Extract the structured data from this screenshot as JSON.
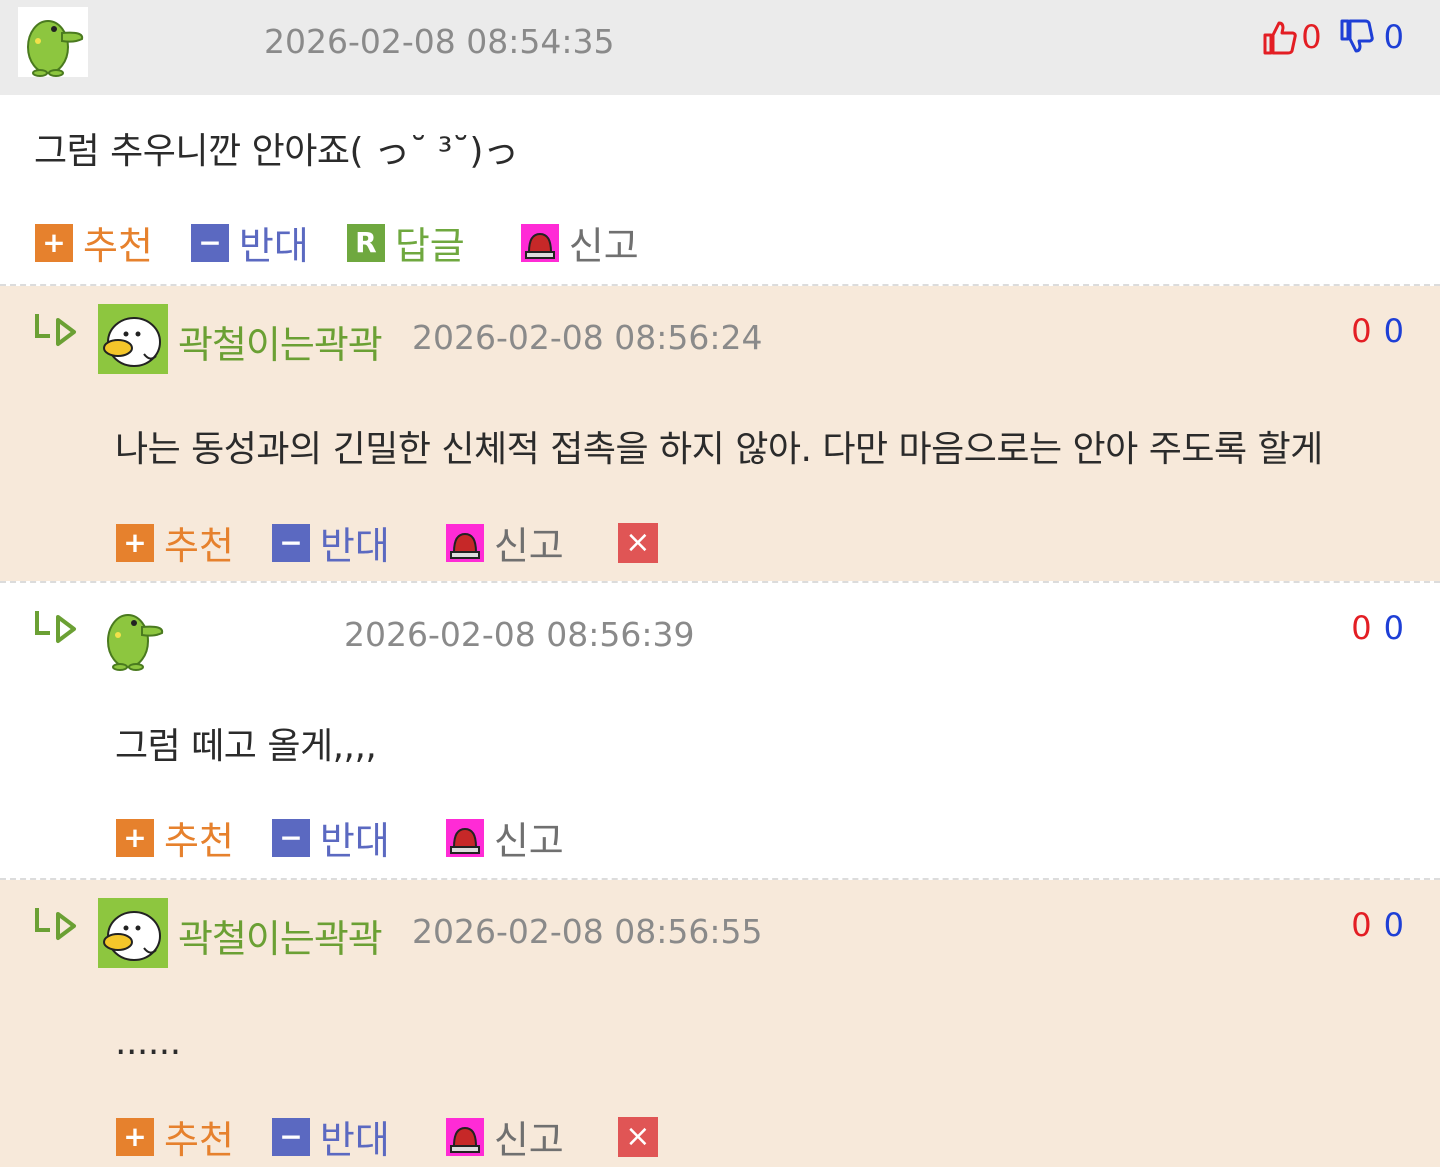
{
  "comments": [
    {
      "type": "comment",
      "nickname": "",
      "date": "2026-02-08 08:54:35",
      "up": "0",
      "down": "0",
      "text": "그럼 추우니깐 안아죠( っ˘ ³˘)っ",
      "actions": {
        "recommend": "추천",
        "oppose": "반대",
        "reply": "답글",
        "report": "신고"
      }
    },
    {
      "type": "reply",
      "nickname": "곽철이는곽곽",
      "date": "2026-02-08 08:56:24",
      "up": "0",
      "down": "0",
      "text": "나는 동성과의 긴밀한 신체적 접촉을 하지 않아. 다만 마음으로는 안아 주도록 할게",
      "actions": {
        "recommend": "추천",
        "oppose": "반대",
        "report": "신고"
      }
    },
    {
      "type": "reply",
      "nickname": "",
      "date": "2026-02-08 08:56:39",
      "up": "0",
      "down": "0",
      "text": "그럼 떼고 올게,,,,",
      "actions": {
        "recommend": "추천",
        "oppose": "반대",
        "report": "신고"
      }
    },
    {
      "type": "reply",
      "nickname": "곽철이는곽곽",
      "date": "2026-02-08 08:56:55",
      "up": "0",
      "down": "0",
      "text": "......",
      "actions": {
        "recommend": "추천",
        "oppose": "반대",
        "report": "신고"
      }
    }
  ],
  "icons": {
    "recommend_glyph": "+",
    "oppose_glyph": "−",
    "reply_glyph": "R",
    "delete_glyph": "×"
  },
  "colors": {
    "header_gray": "#ebebeb",
    "reply_bg": "#f7e9da",
    "recommend": "#e6812d",
    "oppose": "#5b69c1",
    "nickname": "#6ba034",
    "up_count": "#e31e24",
    "down_count": "#1e3fd6"
  }
}
